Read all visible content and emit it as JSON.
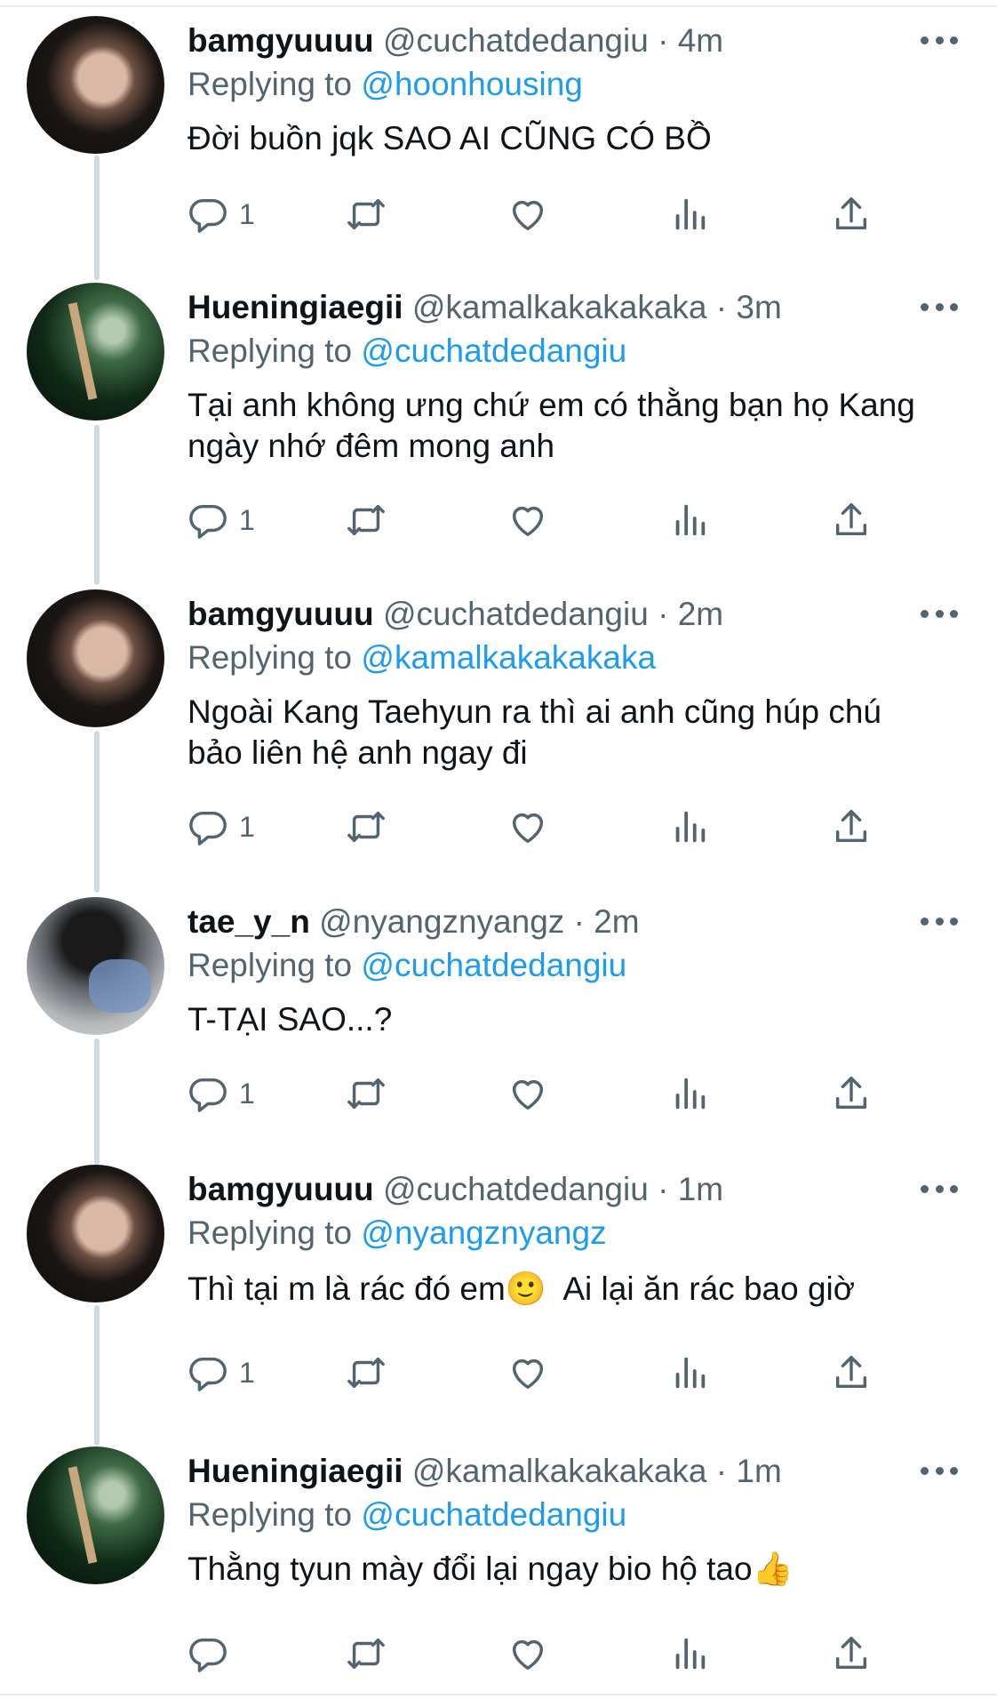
{
  "icons": {
    "reply": "reply-icon",
    "retweet": "retweet-icon",
    "like": "heart-icon",
    "views": "views-icon",
    "share": "share-icon",
    "more": "more-icon"
  },
  "colors": {
    "link": "#1d9bf0",
    "secondary_text": "#536471",
    "primary_text": "#0f1419",
    "thread_line": "#cfd9de"
  },
  "replying_prefix": "Replying to",
  "tweets": [
    {
      "display_name": "bamgyuuuu",
      "handle": "@cuchatdedangiu",
      "separator": "·",
      "time": "4m",
      "replying_to": "@hoonhousing",
      "text": "Đời buồn jqk SAO AI CŨNG CÓ BỒ",
      "reply_count": "1"
    },
    {
      "display_name": "Hueningiaegii",
      "handle": "@kamalkakakakaka",
      "separator": "·",
      "time": "3m",
      "replying_to": "@cuchatdedangiu",
      "text": "Tại anh không ưng chứ em có thằng bạn họ Kang\nngày nhớ đêm mong anh",
      "reply_count": "1"
    },
    {
      "display_name": "bamgyuuuu",
      "handle": "@cuchatdedangiu",
      "separator": "·",
      "time": "2m",
      "replying_to": "@kamalkakakakaka",
      "text": "Ngoài Kang Taehyun ra thì ai anh cũng húp chú\nbảo liên hệ anh ngay đi",
      "reply_count": "1"
    },
    {
      "display_name": "tae_y_n",
      "handle": "@nyangznyangz",
      "separator": "·",
      "time": "2m",
      "replying_to": "@cuchatdedangiu",
      "text": "T-TẠI SAO...?",
      "reply_count": "1"
    },
    {
      "display_name": "bamgyuuuu",
      "handle": "@cuchatdedangiu",
      "separator": "·",
      "time": "1m",
      "replying_to": "@nyangznyangz",
      "text": "Thì tại m là rác đó em🙂  Ai lại ăn rác bao giờ",
      "reply_count": "1"
    },
    {
      "display_name": "Hueningiaegii",
      "handle": "@kamalkakakakaka",
      "separator": "·",
      "time": "1m",
      "replying_to": "@cuchatdedangiu",
      "text": "Thằng tyun mày đổi lại ngay bio hộ tao👍",
      "reply_count": ""
    }
  ]
}
